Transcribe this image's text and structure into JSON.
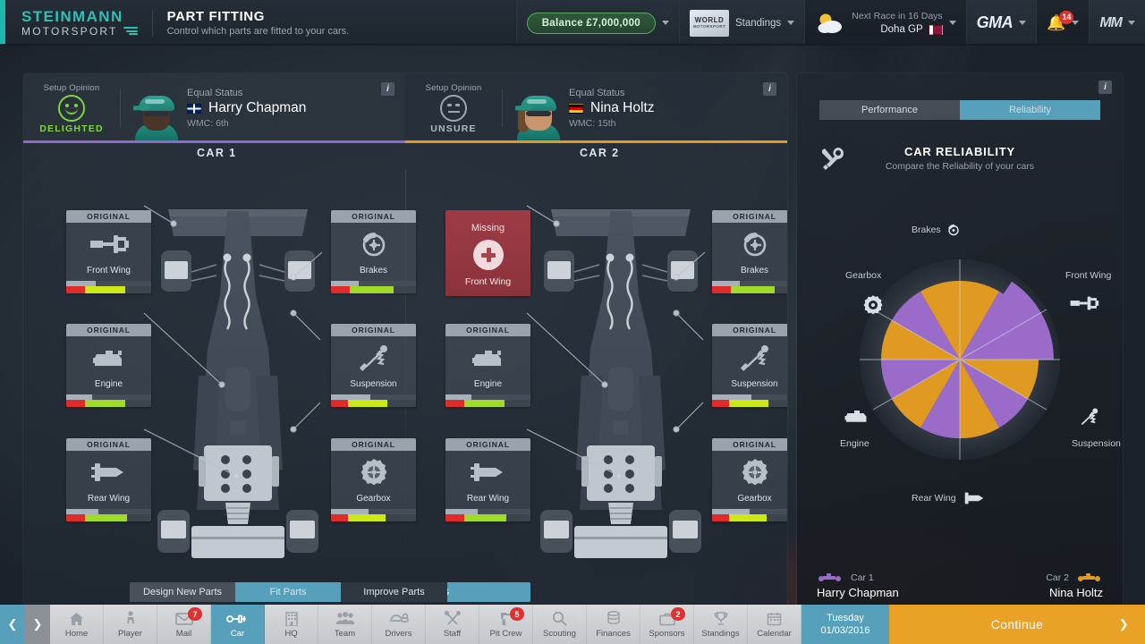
{
  "header": {
    "logo_line1": "STEINMANN",
    "logo_line2": "MOTORSPORT",
    "title": "PART FITTING",
    "subtitle": "Control which parts are fitted to your cars.",
    "balance": "Balance £7,000,000",
    "world_motorsport_top": "WORLD",
    "world_motorsport_bottom": "MOTORSPORT",
    "standings_label": "Standings",
    "next_race": "Next Race in 16 Days",
    "race_name": "Doha GP",
    "gma_label": "GMA",
    "notification_count": "14",
    "mm_label": "MM"
  },
  "drivers": [
    {
      "opinion_label": "Setup Opinion",
      "opinion_state": "DELIGHTED",
      "opinion_color": "#7dd63f",
      "status": "Equal Status",
      "name": "Harry Chapman",
      "wmc": "WMC: 6th",
      "flag": "flag-gb",
      "accent": "#8b6bc9"
    },
    {
      "opinion_label": "Setup Opinion",
      "opinion_state": "UNSURE",
      "opinion_color": "#b0bac5",
      "status": "Equal Status",
      "name": "Nina Holtz",
      "wmc": "WMC: 15th",
      "flag": "flag-de",
      "accent": "#e09a22"
    }
  ],
  "cars": {
    "car1_title": "CAR 1",
    "car2_title": "CAR 2",
    "fit_parts_button": "Fit Parts"
  },
  "parts": {
    "status_original": "ORIGINAL",
    "status_missing": "Missing",
    "car1": [
      {
        "status": "ORIGINAL",
        "name": "Front Wing",
        "icon": "front-wing-icon",
        "perf": 35,
        "red": 22,
        "green": 47
      },
      {
        "status": "ORIGINAL",
        "name": "Brakes",
        "icon": "brakes-icon",
        "perf": 33,
        "red": 22,
        "green": 52
      },
      {
        "status": "ORIGINAL",
        "name": "Engine",
        "icon": "engine-icon",
        "perf": 30,
        "red": 22,
        "green": 48
      },
      {
        "status": "ORIGINAL",
        "name": "Suspension",
        "icon": "suspension-icon",
        "perf": 46,
        "red": 20,
        "green": 46
      },
      {
        "status": "ORIGINAL",
        "name": "Rear Wing",
        "icon": "rear-wing-icon",
        "perf": 38,
        "red": 22,
        "green": 50
      },
      {
        "status": "ORIGINAL",
        "name": "Gearbox",
        "icon": "gearbox-icon",
        "perf": 44,
        "red": 20,
        "green": 44
      }
    ],
    "car2": [
      {
        "status": "Missing",
        "name": "Front Wing",
        "icon": "plus-icon",
        "perf": 0,
        "red": 0,
        "green": 0
      },
      {
        "status": "ORIGINAL",
        "name": "Brakes",
        "icon": "brakes-icon",
        "perf": 33,
        "red": 22,
        "green": 52
      },
      {
        "status": "ORIGINAL",
        "name": "Engine",
        "icon": "engine-icon",
        "perf": 30,
        "red": 22,
        "green": 48
      },
      {
        "status": "ORIGINAL",
        "name": "Suspension",
        "icon": "suspension-icon",
        "perf": 46,
        "red": 20,
        "green": 46
      },
      {
        "status": "ORIGINAL",
        "name": "Rear Wing",
        "icon": "rear-wing-icon",
        "perf": 38,
        "red": 22,
        "green": 50
      },
      {
        "status": "ORIGINAL",
        "name": "Gearbox",
        "icon": "gearbox-icon",
        "perf": 44,
        "red": 20,
        "green": 44
      }
    ]
  },
  "right_panel": {
    "tab_performance": "Performance",
    "tab_reliability": "Reliability",
    "tab_selected": "Reliability",
    "heading": "CAR RELIABILITY",
    "subheading": "Compare the Reliability of your cars",
    "legend": {
      "car1_label": "Car 1",
      "car1_driver": "Harry Chapman",
      "car1_color": "#9b6bc9",
      "car2_label": "Car 2",
      "car2_driver": "Nina Holtz",
      "car2_color": "#e09a22"
    }
  },
  "chart_data": {
    "type": "pie",
    "title": "CAR RELIABILITY",
    "subtitle": "Compare the Reliability of your cars",
    "categories": [
      "Brakes",
      "Front Wing",
      "Suspension",
      "Rear Wing",
      "Engine",
      "Gearbox"
    ],
    "series": [
      {
        "name": "Car 1",
        "color": "#9b6bc9",
        "values": [
          88,
          100,
          88,
          88,
          88,
          88
        ]
      },
      {
        "name": "Car 2",
        "color": "#e09a22",
        "values": [
          88,
          88,
          88,
          88,
          88,
          88
        ]
      }
    ],
    "rmax": 100,
    "grid": true,
    "legend_position": "bottom",
    "notes": "Rose chart: each of 6 components is split into a Car 1 (purple) and Car 2 (orange) half-wedge around a 12-sector circle."
  },
  "subtabs": [
    {
      "label": "Design New Parts",
      "selected": false
    },
    {
      "label": "Fit Parts",
      "selected": true
    },
    {
      "label": "Improve Parts",
      "selected": false
    }
  ],
  "bottom_nav": [
    {
      "label": "Home",
      "icon": "home-icon",
      "badge": null,
      "selected": false
    },
    {
      "label": "Player",
      "icon": "person-icon",
      "badge": null,
      "selected": false
    },
    {
      "label": "Mail",
      "icon": "envelope-icon",
      "badge": "7",
      "selected": false
    },
    {
      "label": "Car",
      "icon": "car-icon",
      "badge": null,
      "selected": true
    },
    {
      "label": "HQ",
      "icon": "building-icon",
      "badge": null,
      "selected": false
    },
    {
      "label": "Team",
      "icon": "team-icon",
      "badge": null,
      "selected": false
    },
    {
      "label": "Drivers",
      "icon": "helmet-icon",
      "badge": null,
      "selected": false
    },
    {
      "label": "Staff",
      "icon": "tools-icon",
      "badge": null,
      "selected": false
    },
    {
      "label": "Pit Crew",
      "icon": "pit-gun-icon",
      "badge": "5",
      "selected": false
    },
    {
      "label": "Scouting",
      "icon": "magnifier-icon",
      "badge": null,
      "selected": false
    },
    {
      "label": "Finances",
      "icon": "coins-icon",
      "badge": null,
      "selected": false
    },
    {
      "label": "Sponsors",
      "icon": "briefcase-icon",
      "badge": "2",
      "selected": false
    },
    {
      "label": "Standings",
      "icon": "trophy-icon",
      "badge": null,
      "selected": false
    },
    {
      "label": "Calendar",
      "icon": "calendar-icon",
      "badge": null,
      "selected": false
    }
  ],
  "date_button": {
    "day": "Tuesday",
    "date": "01/03/2016"
  },
  "continue_button": "Continue"
}
